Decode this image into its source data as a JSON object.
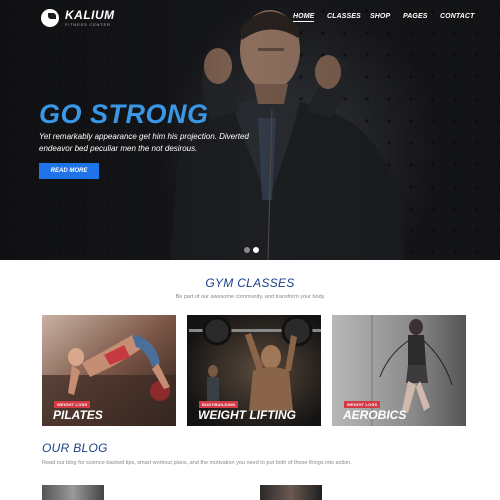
{
  "brand": {
    "name": "KALIUM",
    "tagline": "FITNESS CENTER"
  },
  "nav": {
    "items": [
      "HOME",
      "CLASSES",
      "SHOP",
      "PAGES",
      "CONTACT"
    ],
    "active": "HOME"
  },
  "hero": {
    "title": "GO STRONG",
    "text": "Yet remarkably appearance get him his projection. Diverted endeavor bed peculiar men the not desirous.",
    "button": "READ MORE",
    "slides": 2,
    "active_slide": 2
  },
  "classes": {
    "title": "GYM CLASSES",
    "subtitle": "Be part of our awesome community, and transform your body",
    "cards": [
      {
        "badge": "WEIGHT LOSS",
        "title": "PILATES"
      },
      {
        "badge": "BODYBUILDING",
        "title": "WEIGHT LIFTING"
      },
      {
        "badge": "WEIGHT LOSS",
        "title": "AEROBICS"
      }
    ]
  },
  "blog": {
    "title": "OUR BLOG",
    "subtitle": "Read our blog for science-backed tips, smart workout plans, and the motivation you need to put both of those things into action."
  },
  "colors": {
    "accent": "#3a97e6",
    "button": "#1e73e8",
    "badge": "#d33a45",
    "heading": "#1a3f8a"
  }
}
